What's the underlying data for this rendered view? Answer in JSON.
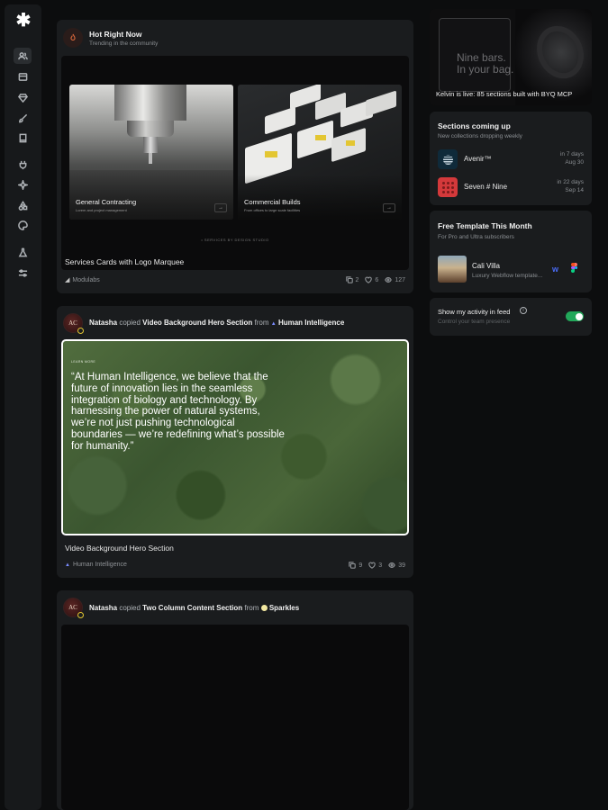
{
  "sidebar": {
    "logo": "✱",
    "icons": [
      "users-icon",
      "archive-icon",
      "gem-icon",
      "brush-icon",
      "book-icon",
      "plug-icon",
      "sparkle-icon",
      "shapes-icon",
      "palette-icon",
      "flask-icon",
      "sliders-icon"
    ]
  },
  "hot": {
    "title": "Hot Right Now",
    "subtitle": "Trending in the community",
    "left_card_title": "General Contracting",
    "left_card_sub": "Lorem and project management",
    "right_card_title": "Commercial Builds",
    "right_card_sub": "From offices to large scale facilities",
    "marquee": "• SERVICES BY DESIGN STUDIO",
    "item_title": "Services Cards with Logo Marquee",
    "author": "Modulabs",
    "copies": "2",
    "likes": "6",
    "views": "127"
  },
  "post1": {
    "user": "Natasha",
    "action": "copied",
    "item": "Video Background Hero Section",
    "from": "from",
    "source": "Human Intelligence",
    "tag": "LEARN MORE",
    "quote": "“At Human Intelligence, we believe that the future of innovation lies in the seamless integration of biology and technology. By harnessing the power of natural systems, we’re not just pushing technological boundaries — we’re redefining what’s possible for humanity.”",
    "item_title": "Video Background Hero Section",
    "author": "Human Intelligence",
    "copies": "9",
    "likes": "3",
    "views": "39"
  },
  "post2": {
    "user": "Natasha",
    "action": "copied",
    "item": "Two Column Content Section",
    "from": "from",
    "source": "Sparkles"
  },
  "promo": {
    "text_line1": "Nine bars.",
    "text_line2": "In your bag.",
    "caption": "Kelvin is live: 85 sections built with BYQ MCP"
  },
  "sections": {
    "title": "Sections coming up",
    "subtitle": "New collections dropping weekly",
    "items": [
      {
        "name": "Avenir™",
        "when": "in 7 days",
        "date": "Aug 30"
      },
      {
        "name": "Seven # Nine",
        "when": "in 22 days",
        "date": "Sep 14"
      }
    ]
  },
  "template": {
    "title": "Free Template This Month",
    "subtitle": "For Pro and Ultra subscribers",
    "name": "Cali Villa",
    "desc": "Luxury Webflow template..."
  },
  "activity": {
    "label": "Show my activity in feed",
    "sub": "Control your team presence",
    "enabled": true,
    "toggle_color": "#22a85a"
  },
  "colors": {
    "accent_green": "#22a85a",
    "card_bg": "#1a1c1e",
    "page_bg": "#0c0d0e"
  }
}
